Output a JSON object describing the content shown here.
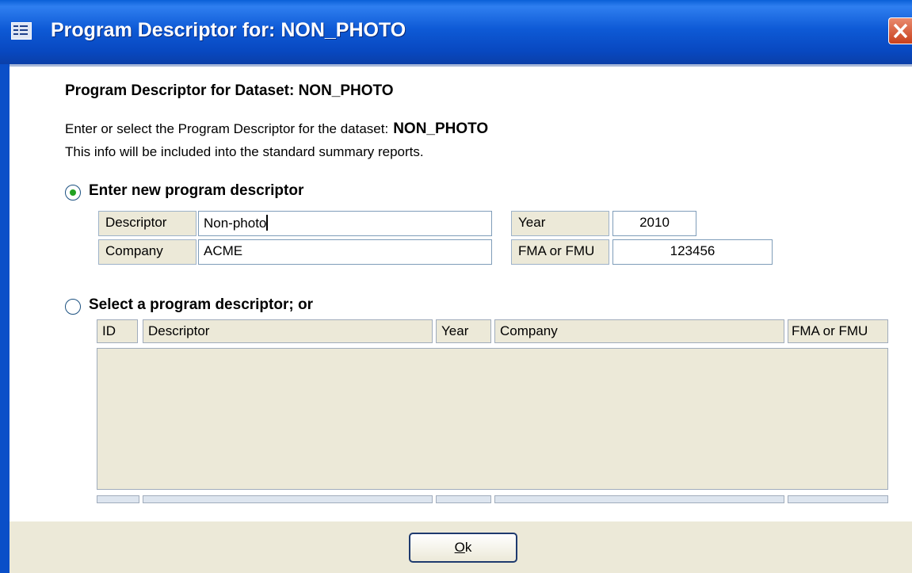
{
  "window": {
    "title": "Program Descriptor for: NON_PHOTO"
  },
  "form": {
    "heading": "Program Descriptor for Dataset: NON_PHOTO",
    "instruction_prefix": "Enter or select the Program Descriptor for the dataset:",
    "instruction_dataset": "NON_PHOTO",
    "instruction_line2": "This info will be included into the standard summary  reports."
  },
  "new_descriptor": {
    "radio_label": "Enter new program descriptor",
    "selected": true,
    "descriptor_label": "Descriptor",
    "descriptor_value": "Non-photo",
    "company_label": "Company",
    "company_value": "ACME",
    "year_label": "Year",
    "year_value": "2010",
    "fma_label": "FMA or FMU",
    "fma_value": "123456"
  },
  "select_descriptor": {
    "radio_label": "Select a program descriptor; or",
    "selected": false,
    "columns": [
      "ID",
      "Descriptor",
      "Year",
      "Company",
      "FMA or FMU"
    ],
    "rows": []
  },
  "buttons": {
    "ok_underlined": "O",
    "ok_rest": "k"
  },
  "colors": {
    "titlebar": "#0a5fd8",
    "form_background": "#ffffff",
    "dialog_background": "#ece9d8",
    "radio_selected": "#21a121"
  }
}
